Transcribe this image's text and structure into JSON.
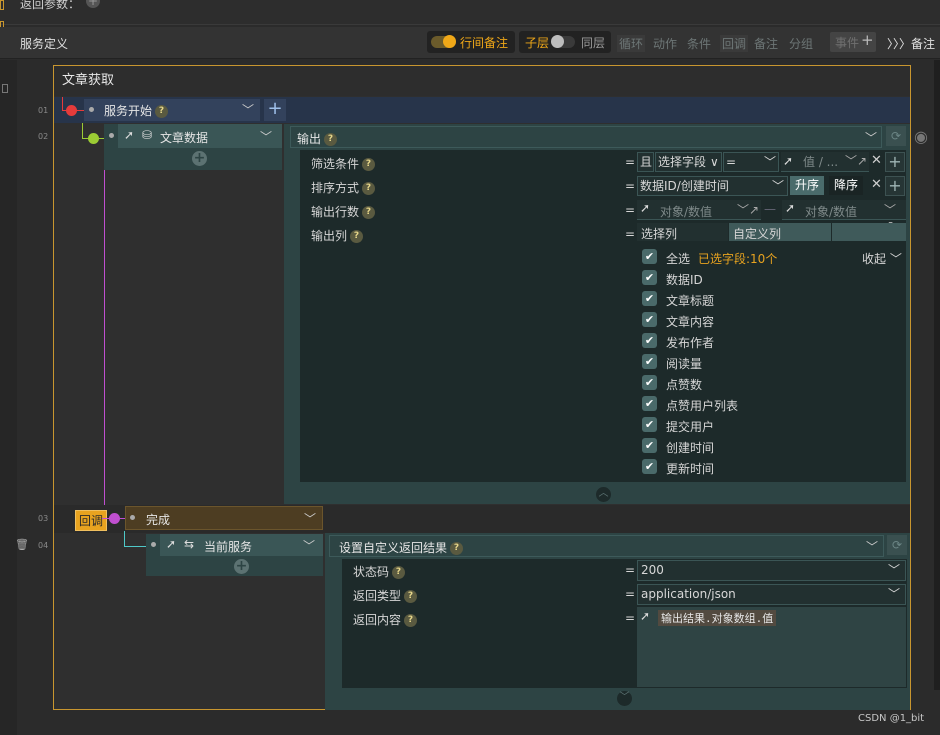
{
  "top": {
    "label": "返回参数："
  },
  "toolbar": {
    "title": "服务定义",
    "inline_note": "行间备注",
    "sublayer": "子层",
    "samelayer": "同层",
    "loop": "循环",
    "action": "动作",
    "condition": "条件",
    "callback": "回调",
    "note": "备注",
    "group": "分组",
    "event": "事件",
    "note_toggle": "〉〉〉备注"
  },
  "service": {
    "title": "文章获取"
  },
  "lines": {
    "l1": "01",
    "l2": "02",
    "l3": "03",
    "l4": "04"
  },
  "start_node": {
    "label": "服务开始",
    "q": "?"
  },
  "data_node": {
    "label": "文章数据"
  },
  "output": {
    "title": "输出",
    "filter_label": "筛选条件",
    "filter_and": "且",
    "filter_field": "选择字段",
    "filter_op": "=",
    "filter_value": "值 / ...",
    "sort_label": "排序方式",
    "sort_field": "数据ID/创建时间",
    "sort_asc": "升序",
    "sort_desc": "降序",
    "rows_label": "输出行数",
    "rows_from": "对象/数值",
    "rows_sep": "—",
    "rows_to": "对象/数值",
    "cols_label": "输出列",
    "eq": "=",
    "tab_select": "选择列",
    "tab_custom": "自定义列",
    "select_all": "全选",
    "selected_count": "已选字段:10个",
    "collapse": "收起",
    "fields": [
      "数据ID",
      "文章标题",
      "文章内容",
      "发布作者",
      "阅读量",
      "点赞数",
      "点赞用户列表",
      "提交用户",
      "创建时间",
      "更新时间"
    ]
  },
  "callback_badge": "回调",
  "finish_node": {
    "label": "完成"
  },
  "current_service": {
    "label": "当前服务"
  },
  "result": {
    "title": "设置自定义返回结果",
    "status_label": "状态码",
    "status_value": "200",
    "type_label": "返回类型",
    "type_value": "application/json",
    "content_label": "返回内容",
    "content_value": "输出结果.对象数组.值"
  },
  "watermark": "CSDN @1_bit",
  "colors": {
    "accent": "#e8a31f",
    "frame": "#c8962f",
    "teal": "#2d4444"
  }
}
